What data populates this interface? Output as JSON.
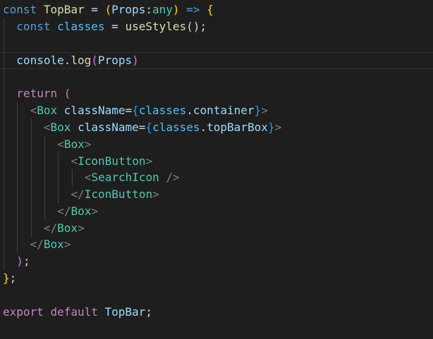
{
  "editor": {
    "language": "tsx",
    "theme": "dark",
    "colors": {
      "background": "#1e1e1e",
      "keyword": "#569cd6",
      "control": "#c586c0",
      "component": "#4ec9b0",
      "function": "#dcdcaa",
      "variable": "#9cdcfe",
      "const_variable": "#4fc1ff",
      "bracket_gold": "#ffd700",
      "bracket_purple": "#da70d6",
      "bracket_blue": "#179fff"
    },
    "lines": [
      {
        "tokens": [
          {
            "t": "const",
            "c": "kw"
          },
          {
            "t": " ",
            "c": "punc"
          },
          {
            "t": "TopBar",
            "c": "fn"
          },
          {
            "t": " = ",
            "c": "punc"
          },
          {
            "t": "(",
            "c": "br1"
          },
          {
            "t": "Props",
            "c": "prop"
          },
          {
            "t": ":",
            "c": "punc"
          },
          {
            "t": "any",
            "c": "cls"
          },
          {
            "t": ")",
            "c": "br1"
          },
          {
            "t": " ",
            "c": "punc"
          },
          {
            "t": "=>",
            "c": "kw"
          },
          {
            "t": " ",
            "c": "punc"
          },
          {
            "t": "{",
            "c": "br1"
          }
        ]
      },
      {
        "tokens": [
          {
            "t": "const",
            "c": "kw"
          },
          {
            "t": " ",
            "c": "punc"
          },
          {
            "t": "classes",
            "c": "var"
          },
          {
            "t": " = ",
            "c": "punc"
          },
          {
            "t": "useStyles",
            "c": "fn"
          },
          {
            "t": "();",
            "c": "punc"
          }
        ]
      },
      {
        "tokens": []
      },
      {
        "current": true,
        "tokens": [
          {
            "t": "console",
            "c": "prop"
          },
          {
            "t": ".",
            "c": "punc"
          },
          {
            "t": "log",
            "c": "fn"
          },
          {
            "t": "(",
            "c": "br2"
          },
          {
            "t": "Props",
            "c": "prop"
          },
          {
            "t": ")",
            "c": "br2"
          }
        ]
      },
      {
        "tokens": []
      },
      {
        "tokens": [
          {
            "t": "return",
            "c": "ctl"
          },
          {
            "t": " ",
            "c": "punc"
          },
          {
            "t": "(",
            "c": "br2"
          }
        ]
      },
      {
        "tokens": [
          {
            "t": "<",
            "c": "tagp"
          },
          {
            "t": "Box",
            "c": "cls"
          },
          {
            "t": " ",
            "c": "punc"
          },
          {
            "t": "className",
            "c": "attr"
          },
          {
            "t": "=",
            "c": "punc"
          },
          {
            "t": "{",
            "c": "br3"
          },
          {
            "t": "classes",
            "c": "var"
          },
          {
            "t": ".",
            "c": "punc"
          },
          {
            "t": "container",
            "c": "prop"
          },
          {
            "t": "}",
            "c": "br3"
          },
          {
            "t": ">",
            "c": "tagp"
          }
        ]
      },
      {
        "tokens": [
          {
            "t": "<",
            "c": "tagp"
          },
          {
            "t": "Box",
            "c": "cls"
          },
          {
            "t": " ",
            "c": "punc"
          },
          {
            "t": "className",
            "c": "attr"
          },
          {
            "t": "=",
            "c": "punc"
          },
          {
            "t": "{",
            "c": "br3"
          },
          {
            "t": "classes",
            "c": "var"
          },
          {
            "t": ".",
            "c": "punc"
          },
          {
            "t": "topBarBox",
            "c": "prop"
          },
          {
            "t": "}",
            "c": "br3"
          },
          {
            "t": ">",
            "c": "tagp"
          }
        ]
      },
      {
        "tokens": [
          {
            "t": "<",
            "c": "tagp"
          },
          {
            "t": "Box",
            "c": "cls"
          },
          {
            "t": ">",
            "c": "tagp"
          }
        ]
      },
      {
        "tokens": [
          {
            "t": "<",
            "c": "tagp"
          },
          {
            "t": "IconButton",
            "c": "cls"
          },
          {
            "t": ">",
            "c": "tagp"
          }
        ]
      },
      {
        "tokens": [
          {
            "t": "<",
            "c": "tagp"
          },
          {
            "t": "SearchIcon",
            "c": "cls"
          },
          {
            "t": " />",
            "c": "tagp"
          }
        ]
      },
      {
        "tokens": [
          {
            "t": "</",
            "c": "tagp"
          },
          {
            "t": "IconButton",
            "c": "cls"
          },
          {
            "t": ">",
            "c": "tagp"
          }
        ]
      },
      {
        "tokens": [
          {
            "t": "</",
            "c": "tagp"
          },
          {
            "t": "Box",
            "c": "cls"
          },
          {
            "t": ">",
            "c": "tagp"
          }
        ]
      },
      {
        "tokens": [
          {
            "t": "</",
            "c": "tagp"
          },
          {
            "t": "Box",
            "c": "cls"
          },
          {
            "t": ">",
            "c": "tagp"
          }
        ]
      },
      {
        "tokens": [
          {
            "t": "</",
            "c": "tagp"
          },
          {
            "t": "Box",
            "c": "cls"
          },
          {
            "t": ">",
            "c": "tagp"
          }
        ]
      },
      {
        "tokens": [
          {
            "t": ")",
            "c": "br2"
          },
          {
            "t": ";",
            "c": "punc"
          }
        ]
      },
      {
        "tokens": [
          {
            "t": "}",
            "c": "br1"
          },
          {
            "t": ";",
            "c": "punc"
          }
        ]
      },
      {
        "tokens": []
      },
      {
        "tokens": [
          {
            "t": "export",
            "c": "ctl"
          },
          {
            "t": " ",
            "c": "punc"
          },
          {
            "t": "default",
            "c": "ctl"
          },
          {
            "t": " ",
            "c": "punc"
          },
          {
            "t": "TopBar",
            "c": "prop"
          },
          {
            "t": ";",
            "c": "punc"
          }
        ]
      }
    ]
  }
}
